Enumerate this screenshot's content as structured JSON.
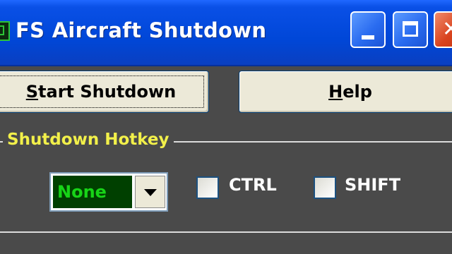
{
  "window": {
    "title": "FS Aircraft Shutdown",
    "controls": [
      "minimize",
      "maximize",
      "close"
    ]
  },
  "buttons": {
    "start_prefix": "",
    "start_mnemonic": "S",
    "start_rest": "tart Shutdown",
    "help_mnemonic": "H",
    "help_rest": "elp"
  },
  "hotkey_group": {
    "title": "Shutdown Hotkey",
    "key_select": {
      "value": "None"
    },
    "modifiers": [
      {
        "label": "CTRL",
        "checked": false
      },
      {
        "label": "SHIFT",
        "checked": false
      }
    ]
  },
  "colors": {
    "titlebar_blue": "#0047d8",
    "panel_bg": "#4a4a4a",
    "group_title": "#f2f04a",
    "combo_bg": "#004000",
    "combo_text": "#17d417"
  }
}
